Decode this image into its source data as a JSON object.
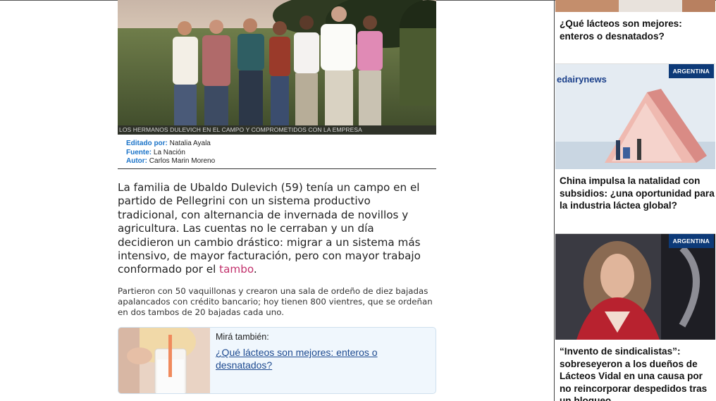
{
  "article": {
    "photo_caption": "LOS HERMANOS DULEVICH EN EL CAMPO Y COMPROMETIDOS CON LA EMPRESA",
    "credits": {
      "edited_label": "Editado por:",
      "edited_value": "Natalia Ayala",
      "source_label": "Fuente:",
      "source_value": "La Nación",
      "author_label": "Autor:",
      "author_value": "Carlos Marin Moreno"
    },
    "lead_text": "La familia de Ubaldo Dulevich (59) tenía un campo en el partido de Pellegrini con un sistema productivo tradicional, con alternancia de invernada de novillos y agricultura. Las cuentas no le cerraban y un día decidieron un cambio drástico: migrar a un sistema más intensivo, de mayor facturación, pero con mayor trabajo conformado por el ",
    "lead_link": "tambo",
    "lead_end": ".",
    "body_text": "Partieron con 50 vaquillonas y crearon una sala de ordeño de diez bajadas apalancados con crédito bancario; hoy tienen 800 vientres, que se ordeñan en dos tambos de 20 bajadas cada uno.",
    "related": {
      "label": "Mirá también:",
      "link": "¿Qué lácteos son mejores: enteros o desnatados?"
    }
  },
  "sidebar": {
    "cards": [
      {
        "title": "¿Qué lácteos son mejores: enteros o desnatados?"
      },
      {
        "badge": "ARGENTINA",
        "logo": "edairynews",
        "title": "China impulsa la natalidad con subsidios: ¿una oportunidad para la industria láctea global?"
      },
      {
        "badge": "ARGENTINA",
        "title": "“Invento de sindicalistas”: sobreseyeron a los dueños de Lácteos Vidal en una causa por no reincorporar despedidos tras un bloqueo"
      }
    ]
  },
  "colors": {
    "link_blue": "#1d4a90",
    "credit_label": "#1a73c8",
    "tambo_link": "#c2306b",
    "badge_bg": "#0d3a78"
  }
}
